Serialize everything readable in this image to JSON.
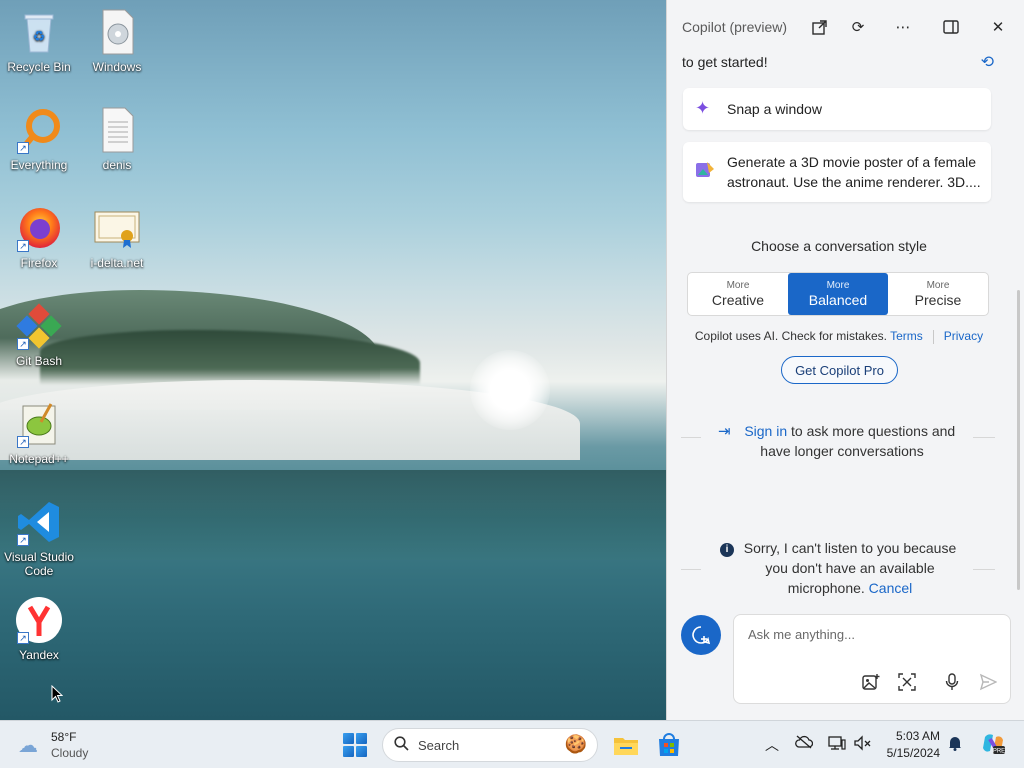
{
  "desktop": {
    "icons": [
      {
        "label": "Recycle Bin",
        "icon": "recycle-bin-icon"
      },
      {
        "label": "Windows",
        "icon": "disc-file-icon"
      },
      {
        "label": "Everything",
        "icon": "everything-search-icon"
      },
      {
        "label": "denis",
        "icon": "text-file-icon"
      },
      {
        "label": "Firefox",
        "icon": "firefox-icon"
      },
      {
        "label": "i-delta.net",
        "icon": "certificate-icon"
      },
      {
        "label": "Git Bash",
        "icon": "git-bash-icon"
      },
      {
        "label": "Notepad++",
        "icon": "notepadpp-icon"
      },
      {
        "label": "Visual Studio Code",
        "icon": "vscode-icon"
      },
      {
        "label": "Yandex",
        "icon": "yandex-icon"
      }
    ]
  },
  "copilot": {
    "title": "Copilot (preview)",
    "started_text": "to get started!",
    "suggestions": [
      {
        "text": "Snap a window",
        "icon": "sparkle-icon"
      },
      {
        "text": "Generate a 3D movie poster of a female astronaut. Use the anime renderer. 3D....",
        "icon": "image-create-icon"
      }
    ],
    "style_title": "Choose a conversation style",
    "styles": [
      {
        "small": "More",
        "large": "Creative"
      },
      {
        "small": "More",
        "large": "Balanced"
      },
      {
        "small": "More",
        "large": "Precise"
      }
    ],
    "disclaimer": "Copilot uses AI. Check for mistakes.",
    "terms": "Terms",
    "privacy": "Privacy",
    "pro_button": "Get Copilot Pro",
    "signin_link": "Sign in",
    "signin_rest": " to ask more questions and have longer conversations",
    "sorry_text": "Sorry, I can't listen to you because you don't have an available microphone.",
    "cancel": "Cancel",
    "input_placeholder": "Ask me anything..."
  },
  "taskbar": {
    "temp": "58°F",
    "condition": "Cloudy",
    "search_label": "Search",
    "time": "5:03 AM",
    "date": "5/15/2024"
  },
  "colors": {
    "accent": "#1a67c8",
    "taskbar": "#e9eef3",
    "panel": "#f3f4f6"
  }
}
